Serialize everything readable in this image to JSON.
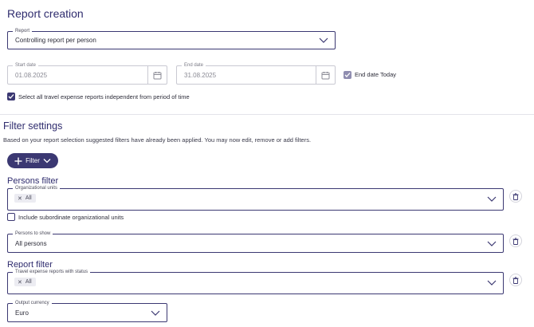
{
  "report_creation": {
    "title": "Report creation",
    "report_field": {
      "label": "Report",
      "value": "Controlling report per person"
    },
    "start_date": {
      "label": "Start date",
      "value": "01.08.2025"
    },
    "end_date": {
      "label": "End date",
      "value": "31.08.2025"
    },
    "end_date_today": {
      "label": "End date Today",
      "checked": true
    },
    "select_all": {
      "label": "Select all travel expense reports independent from period of time",
      "checked": true
    }
  },
  "filter_settings": {
    "title": "Filter settings",
    "description": "Based on your report selection suggested filters have already been applied. You may now edit, remove or add filters.",
    "filter_button_label": "Filter"
  },
  "persons_filter": {
    "title": "Persons filter",
    "org_units": {
      "label": "Organizational units",
      "chip": "All"
    },
    "include_subordinate": {
      "label": "Include subordinate organizational units",
      "checked": false
    },
    "persons_to_show": {
      "label": "Persons to show",
      "value": "All persons"
    }
  },
  "report_filter": {
    "title": "Report filter",
    "status_field": {
      "label": "Travel expense reports with status",
      "chip": "All"
    },
    "output_currency": {
      "label": "Output currency",
      "value": "Euro"
    }
  },
  "colors": {
    "primary": "#3b3872",
    "title": "#2f2c6e",
    "chip_bg": "#ececf2",
    "muted_check": "#8f8db0"
  }
}
